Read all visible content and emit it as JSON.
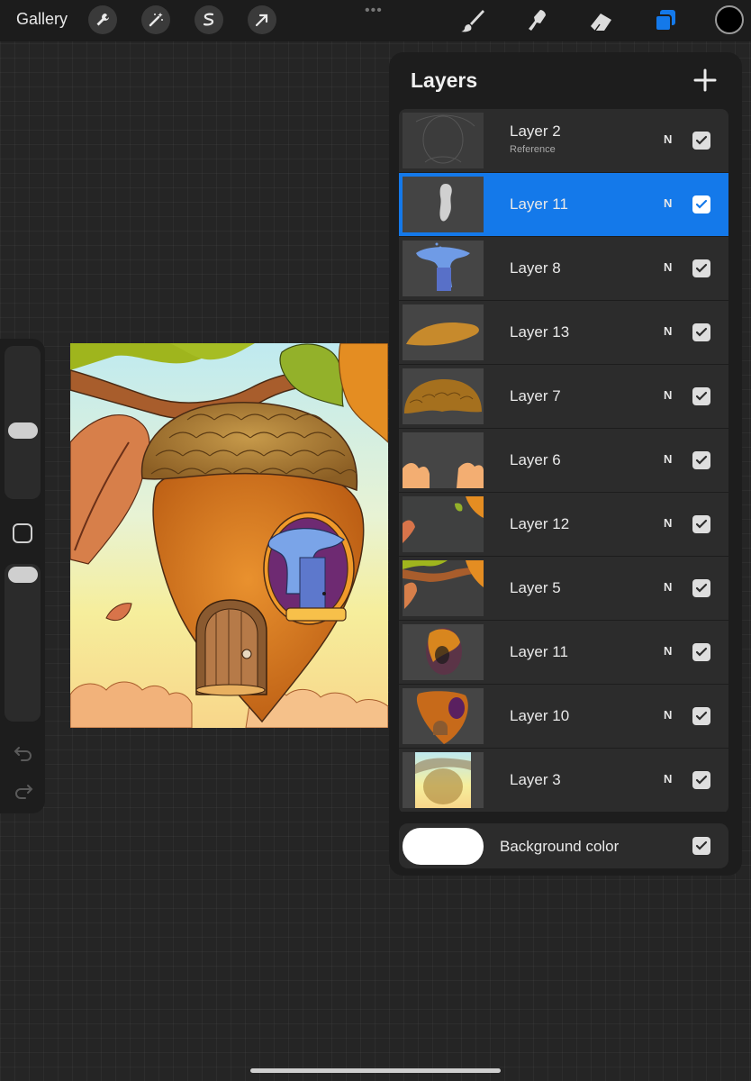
{
  "topbar": {
    "gallery_label": "Gallery",
    "left_tools": [
      "wrench-icon",
      "magic-wand-icon",
      "selection-icon",
      "transform-arrow-icon"
    ],
    "more_dots": "•••",
    "right_tools": [
      "brush-icon",
      "smudge-icon",
      "eraser-icon",
      "layers-icon"
    ],
    "current_color": "#000000",
    "active_tool_color": "#1479ea"
  },
  "layers_panel": {
    "title": "Layers",
    "add_icon": "plus-icon",
    "layers": [
      {
        "name": "Layer 2",
        "subtitle": "Reference",
        "blend": "N",
        "visible": true,
        "selected": false
      },
      {
        "name": "Layer 11",
        "subtitle": "",
        "blend": "N",
        "visible": true,
        "selected": true
      },
      {
        "name": "Layer 8",
        "subtitle": "",
        "blend": "N",
        "visible": true,
        "selected": false
      },
      {
        "name": "Layer 13",
        "subtitle": "",
        "blend": "N",
        "visible": true,
        "selected": false
      },
      {
        "name": "Layer 7",
        "subtitle": "",
        "blend": "N",
        "visible": true,
        "selected": false
      },
      {
        "name": "Layer 6",
        "subtitle": "",
        "blend": "N",
        "visible": true,
        "selected": false
      },
      {
        "name": "Layer 12",
        "subtitle": "",
        "blend": "N",
        "visible": true,
        "selected": false
      },
      {
        "name": "Layer 5",
        "subtitle": "",
        "blend": "N",
        "visible": true,
        "selected": false
      },
      {
        "name": "Layer 11",
        "subtitle": "",
        "blend": "N",
        "visible": true,
        "selected": false
      },
      {
        "name": "Layer 10",
        "subtitle": "",
        "blend": "N",
        "visible": true,
        "selected": false
      },
      {
        "name": "Layer 3",
        "subtitle": "",
        "blend": "N",
        "visible": true,
        "selected": false
      }
    ],
    "background": {
      "label": "Background color",
      "color": "#ffffff",
      "visible": true
    }
  },
  "sidebar": {
    "brush_size_level": 0.45,
    "opacity_level": 0.93,
    "undo_icon": "undo-icon",
    "redo_icon": "redo-icon"
  }
}
